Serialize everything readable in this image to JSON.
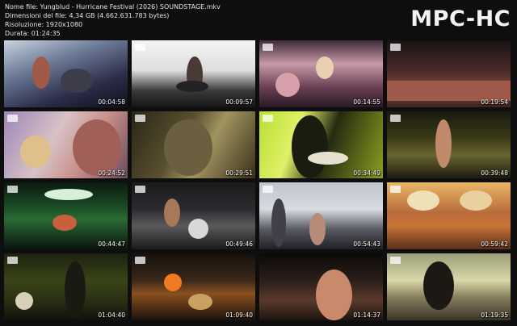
{
  "info": {
    "line1": "Nome file: Yungblud - Hurricane Festival (2026) SOUNDSTAGE.mkv",
    "line2": "Dimensioni del file: 4,34 GB (4.662.631.783 bytes)",
    "line3": "Risoluzione: 1920x1080",
    "line4": "Durata: 01:24:35"
  },
  "logo": "MPC-HC",
  "thumbnails": [
    {
      "time": "00:04:58"
    },
    {
      "time": "00:09:57"
    },
    {
      "time": "00:14:55"
    },
    {
      "time": "00:19:54"
    },
    {
      "time": "00:24:52"
    },
    {
      "time": "00:29:51"
    },
    {
      "time": "00:34:49"
    },
    {
      "time": "00:39:48"
    },
    {
      "time": "00:44:47"
    },
    {
      "time": "00:49:46"
    },
    {
      "time": "00:54:43"
    },
    {
      "time": "00:59:42"
    },
    {
      "time": "01:04:40"
    },
    {
      "time": "01:09:40"
    },
    {
      "time": "01:14:37"
    },
    {
      "time": "01:19:35"
    }
  ]
}
